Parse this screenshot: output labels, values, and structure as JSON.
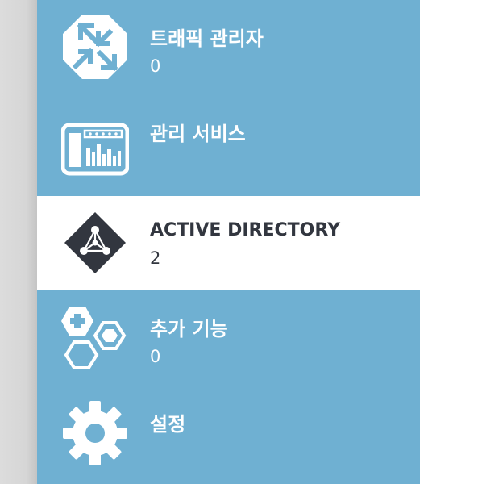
{
  "nav": {
    "items": [
      {
        "label": "트래픽 관리자",
        "count": "0",
        "icon": "traffic-manager-icon",
        "selected": false
      },
      {
        "label": "관리 서비스",
        "count": "",
        "icon": "management-services-icon",
        "selected": false
      },
      {
        "label": "ACTIVE DIRECTORY",
        "count": "2",
        "icon": "active-directory-icon",
        "selected": true
      },
      {
        "label": "추가 기능",
        "count": "0",
        "icon": "add-ons-icon",
        "selected": false
      },
      {
        "label": "설정",
        "count": "",
        "icon": "gear-icon",
        "selected": false
      }
    ]
  },
  "colors": {
    "nav_background": "#6fb0d2",
    "selected_background": "#ffffff",
    "selected_text": "#32363f",
    "text": "#ffffff",
    "left_edge": "#d6d6d6"
  }
}
